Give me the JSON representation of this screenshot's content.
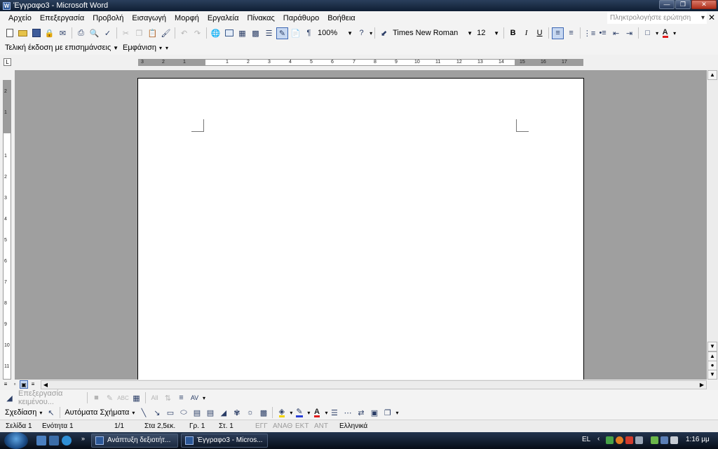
{
  "window": {
    "title": "Έγγραφο3 - Microsoft Word"
  },
  "menu": {
    "items": [
      "Αρχείο",
      "Επεξεργασία",
      "Προβολή",
      "Εισαγωγή",
      "Μορφή",
      "Εργαλεία",
      "Πίνακας",
      "Παράθυρο",
      "Βοήθεια"
    ],
    "help_placeholder": "Πληκτρολογήστε ερώτηση"
  },
  "standard_toolbar": {
    "zoom": "100%"
  },
  "formatting_toolbar": {
    "font": "Times New Roman",
    "size": "12"
  },
  "reviewing_toolbar": {
    "display_mode": "Τελική έκδοση με επισημάνσεις",
    "show_label": "Εμφάνιση"
  },
  "ruler": {
    "h_numbers": [
      "3",
      "2",
      "1",
      "1",
      "2",
      "3",
      "4",
      "5",
      "6",
      "7",
      "8",
      "9",
      "10",
      "11",
      "12",
      "13",
      "14",
      "15",
      "16",
      "17"
    ],
    "v_numbers": [
      "2",
      "1",
      "1",
      "2",
      "3",
      "4",
      "5",
      "6",
      "7",
      "8",
      "9",
      "10",
      "11"
    ]
  },
  "text_toolbar": {
    "edit_text": "Επεξεργασία κειμένου..."
  },
  "drawing_toolbar": {
    "draw_label": "Σχεδίαση",
    "autoshapes_label": "Αυτόματα Σχήματα"
  },
  "status": {
    "page": "Σελίδα 1",
    "section": "Ενότητα 1",
    "pages": "1/1",
    "at": "Στα 2,5εκ.",
    "line": "Γρ. 1",
    "col": "Στ. 1",
    "rec": "ΕΓΓ",
    "trk": "ΑΝΑΘ",
    "ext": "ΕΚΤ",
    "ovr": "ΑΝΤ",
    "language": "Ελληνικά"
  },
  "taskbar": {
    "tasks": [
      "Ανάπτυξη δεξιοτήτ...",
      "Έγγραφο3 - Micros..."
    ],
    "lang": "EL",
    "time": "1:16 μμ"
  }
}
